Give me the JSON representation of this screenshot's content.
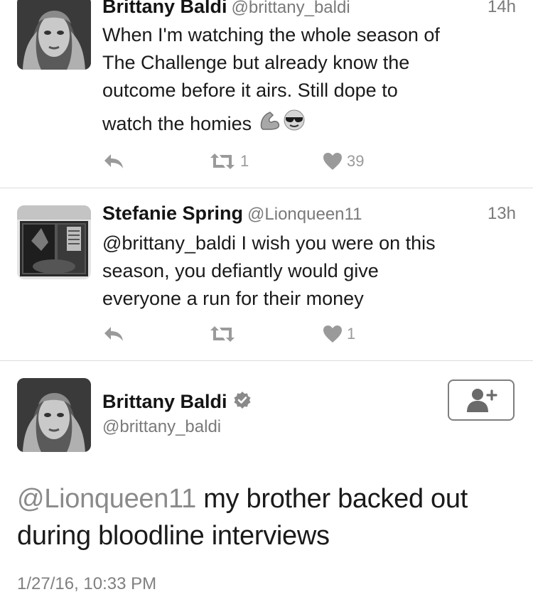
{
  "tweets": [
    {
      "name": "Brittany Baldi",
      "handle": "@brittany_baldi",
      "time": "14h",
      "text_lines": [
        "When I'm watching the whole season of",
        "The Challenge but already know the",
        "outcome before it airs. Still dope to",
        "watch the homies"
      ],
      "emoji_icons": [
        "flexed-biceps-icon",
        "sunglasses-face-icon"
      ],
      "retweets": "1",
      "likes": "39"
    },
    {
      "name": "Stefanie Spring",
      "handle": "@Lionqueen11",
      "time": "13h",
      "text_lines": [
        "@brittany_baldi I wish you were on this",
        "season, you defiantly would give",
        "everyone a run for their money"
      ],
      "retweets": "",
      "likes": "1"
    }
  ],
  "detail": {
    "name": "Brittany Baldi",
    "handle": "@brittany_baldi",
    "verified": true,
    "mention": "@Lionqueen11",
    "text_line1_rest": " my brother backed out",
    "text_line2": "during bloodline interviews",
    "timestamp": "1/27/16, 10:33 PM",
    "follow_icon": "add-user-icon"
  },
  "colors": {
    "text": "#141414",
    "secondary": "#7a7a7a",
    "icon": "#9a9a9a",
    "divider": "#dddddd"
  }
}
